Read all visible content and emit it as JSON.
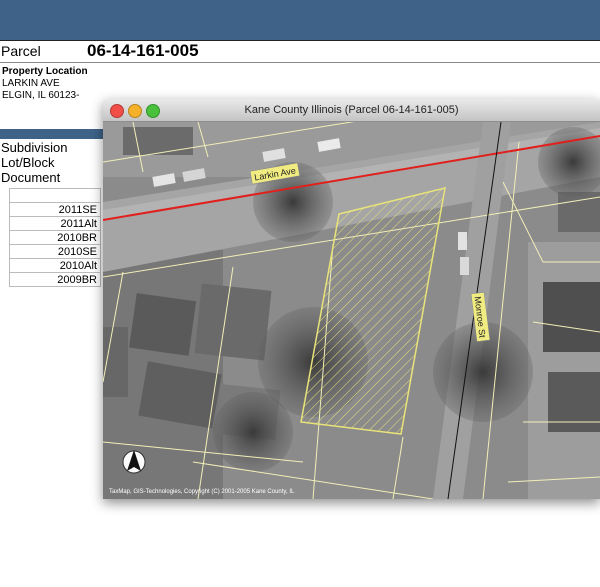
{
  "parcel": {
    "label": "Parcel",
    "number": "06-14-161-005"
  },
  "location": {
    "title": "Property Location",
    "street": "LARKIN AVE",
    "city": "ELGIN, IL 60123-"
  },
  "details": {
    "subdivision": "Subdivision",
    "lot_block": "Lot/Block",
    "document": "Document"
  },
  "tax_years": [
    "2011SE",
    "2011Alt",
    "2010BR",
    "2010SE",
    "2010Alt",
    "2009BR"
  ],
  "window": {
    "title": "Kane County Illinois (Parcel 06-14-161-005)"
  },
  "map": {
    "street_larkin": "Larkin Ave",
    "street_monroe": "Monroe St",
    "copyright": "TaxMap, GIS-Technologies, Copyright (C) 2001-2005 Kane County, IL"
  },
  "colors": {
    "header_bar": "#3f6289",
    "road_line": "#e0201c",
    "parcel_outline": "#e8e37a"
  }
}
